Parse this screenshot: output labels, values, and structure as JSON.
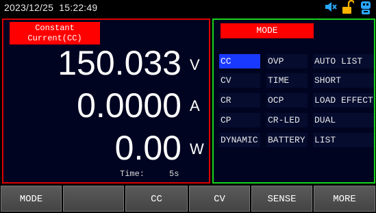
{
  "status_bar": {
    "date": "2023/12/25",
    "time": "15:22:49",
    "icons": [
      "speaker-muted-icon",
      "unlocked-padlock-icon",
      "remote-bot-icon"
    ]
  },
  "measurement_panel": {
    "mode_line1": "Constant",
    "mode_line2": "Current(CC)",
    "voltage": "150.033",
    "voltage_unit": "V",
    "current": "0.0000",
    "current_unit": "A",
    "power": "0.00",
    "power_unit": "W",
    "time_label": "Time:",
    "time_value": "5s"
  },
  "mode_panel": {
    "title": "MODE",
    "selected": "CC",
    "options": [
      [
        "CC",
        "OVP",
        "AUTO LIST"
      ],
      [
        "CV",
        "TIME",
        "SHORT"
      ],
      [
        "CR",
        "OCP",
        "LOAD EFFECT"
      ],
      [
        "CP",
        "CR-LED",
        "DUAL"
      ],
      [
        "DYNAMIC",
        "BATTERY",
        "LIST"
      ]
    ]
  },
  "softkeys": [
    "MODE",
    "",
    "CC",
    "CV",
    "SENSE",
    "MORE"
  ],
  "colors": {
    "panel_border_left": "#dd0000",
    "panel_border_right": "#19d41b",
    "highlight": "#ff0000",
    "selection": "#1a39ff",
    "speaker_icon": "#2aa6ff",
    "lock_icon": "#ffb400"
  }
}
